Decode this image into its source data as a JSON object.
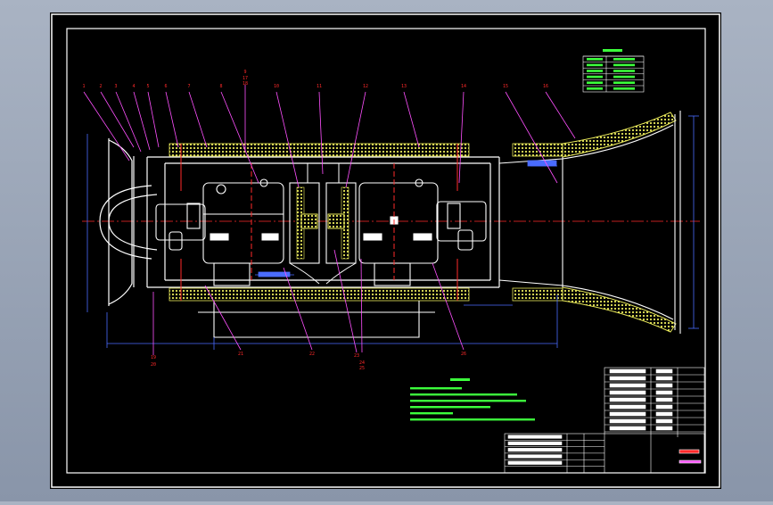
{
  "drawing": {
    "background": "#000000",
    "frame_color": "#ffffff",
    "outline_color": "#ffffff",
    "hatch_color": "#e8e85a",
    "dim_color": "#4a6cff",
    "leader_color": "#ff50ff",
    "text_color": "#3cff3c",
    "tag_color": "#ff2a2a",
    "part_number_color": "#ffff00"
  },
  "callouts_top": [
    "1",
    "2",
    "3",
    "4",
    "5",
    "6",
    "7",
    "8",
    "9",
    "10",
    "11",
    "12",
    "13",
    "14",
    "15",
    "16",
    "17",
    "18"
  ],
  "callouts_bottom": [
    "19",
    "20",
    "21",
    "22",
    "23",
    "24",
    "25",
    "26"
  ],
  "legend_table": {
    "rows": 6
  },
  "notes": {
    "line_count": 6
  },
  "title_block": {
    "rows": 10
  }
}
